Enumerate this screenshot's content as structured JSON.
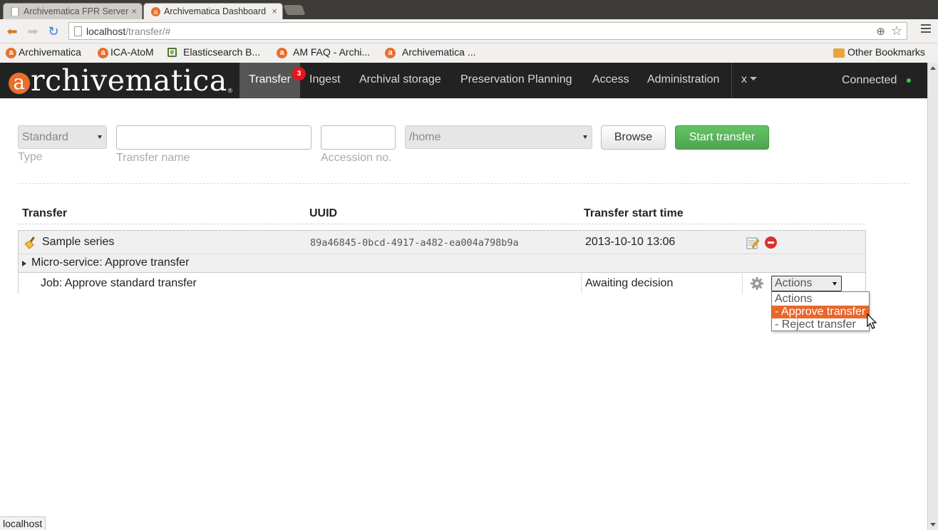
{
  "browser": {
    "tabs": [
      {
        "title": "Archivematica FPR Server",
        "active": false
      },
      {
        "title": "Archivematica Dashboard",
        "active": true
      }
    ],
    "url_host": "localhost",
    "url_path": "/transfer/#",
    "bookmarks": [
      {
        "label": "Archivematica",
        "icon": "archivematica-icon"
      },
      {
        "label": "ICA-AtoM",
        "icon": "archivematica-icon"
      },
      {
        "label": "Elasticsearch B...",
        "icon": "elasticsearch-icon"
      },
      {
        "label": "AM FAQ - Archi...",
        "icon": "archivematica-icon"
      },
      {
        "label": "Archivematica ...",
        "icon": "archivematica-icon"
      }
    ],
    "other_bookmarks": "Other Bookmarks",
    "status_url": "localhost"
  },
  "app": {
    "logo_letter": "a",
    "logo_rest": "rchivematica",
    "logo_reg": "®",
    "nav": [
      {
        "label": "Transfer",
        "active": true,
        "badge": "3"
      },
      {
        "label": "Ingest"
      },
      {
        "label": "Archival storage"
      },
      {
        "label": "Preservation Planning"
      },
      {
        "label": "Access"
      },
      {
        "label": "Administration"
      }
    ],
    "user_menu": "x",
    "connection_status": "Connected",
    "status_color": "#3ec34c",
    "accent_color": "#e8702a"
  },
  "form": {
    "type_value": "Standard",
    "type_label": "Type",
    "name_label": "Transfer name",
    "name_value": "",
    "accession_label": "Accession no.",
    "accession_value": "",
    "path_value": "/home",
    "browse_label": "Browse",
    "start_label": "Start transfer"
  },
  "table": {
    "headers": [
      "Transfer",
      "UUID",
      "Transfer start time"
    ],
    "transfer": {
      "name": "Sample series",
      "uuid": "89a46845-0bcd-4917-a482-ea004a798b9a",
      "start_time": "2013-10-10 13:06"
    },
    "microservice": "Micro-service: Approve transfer",
    "job": {
      "name": "Job: Approve standard transfer",
      "status": "Awaiting decision",
      "actions_value": "Actions",
      "actions_options": [
        "Actions",
        "- Approve transfer",
        "- Reject transfer"
      ],
      "highlighted_option": 1
    }
  }
}
